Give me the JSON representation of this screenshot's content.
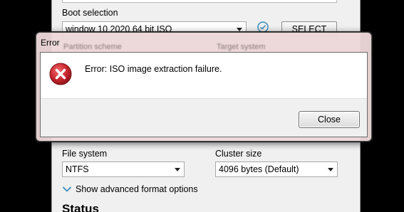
{
  "rufus": {
    "boot_selection_label": "Boot selection",
    "boot_selection_value": "window 10  2020 64 bit.ISO",
    "select_button": "SELECT",
    "partition_scheme_label": "Partition scheme",
    "target_system_label": "Target system",
    "file_system_label": "File system",
    "file_system_value": "NTFS",
    "cluster_size_label": "Cluster size",
    "cluster_size_value": "4096 bytes (Default)",
    "advanced_options_label": "Show advanced format options",
    "status_title": "Status"
  },
  "dialog": {
    "title": "Error",
    "message": "Error: ISO image extraction failure.",
    "close_button": "Close"
  },
  "colors": {
    "accent": "#3c8dbc",
    "error_red": "#c6262e",
    "dialog_frame": "#ecd7d7"
  },
  "icons": {
    "valid": "check-circle-icon",
    "error": "error-x-icon",
    "expand": "chevron-down-icon"
  }
}
